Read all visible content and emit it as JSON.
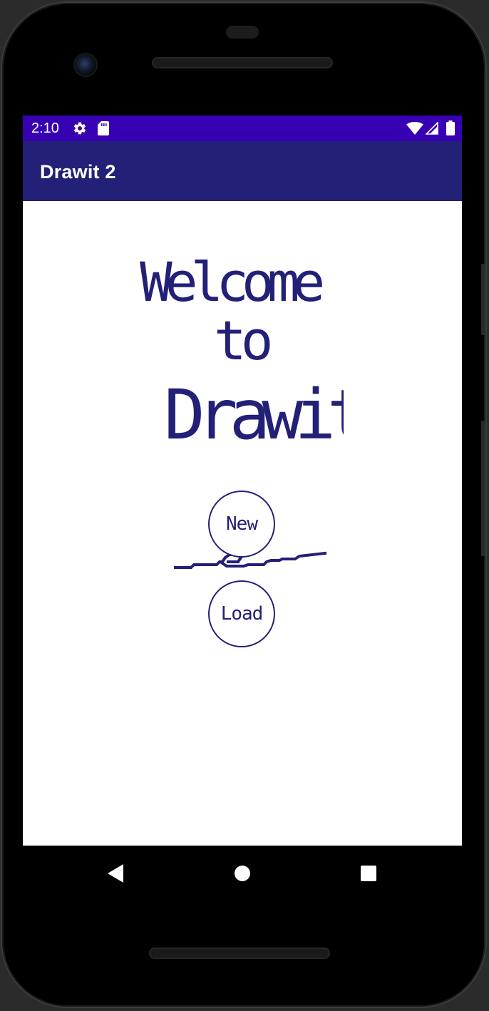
{
  "status_bar": {
    "time": "2:10",
    "left_icons": [
      "settings-icon",
      "sd-card-icon"
    ],
    "right_icons": [
      "wifi-icon",
      "cellular-signal-icon",
      "battery-icon"
    ],
    "background": "#3700b3"
  },
  "app_bar": {
    "title": "Drawit 2",
    "background": "#232077"
  },
  "welcome": {
    "line1": "Welcome",
    "line2": "to",
    "line3": "Drawit",
    "color": "#232077"
  },
  "buttons": {
    "new_label": "New",
    "load_label": "Load"
  },
  "nav_bar": {
    "icons": [
      "back-icon",
      "home-icon",
      "recents-icon"
    ]
  }
}
